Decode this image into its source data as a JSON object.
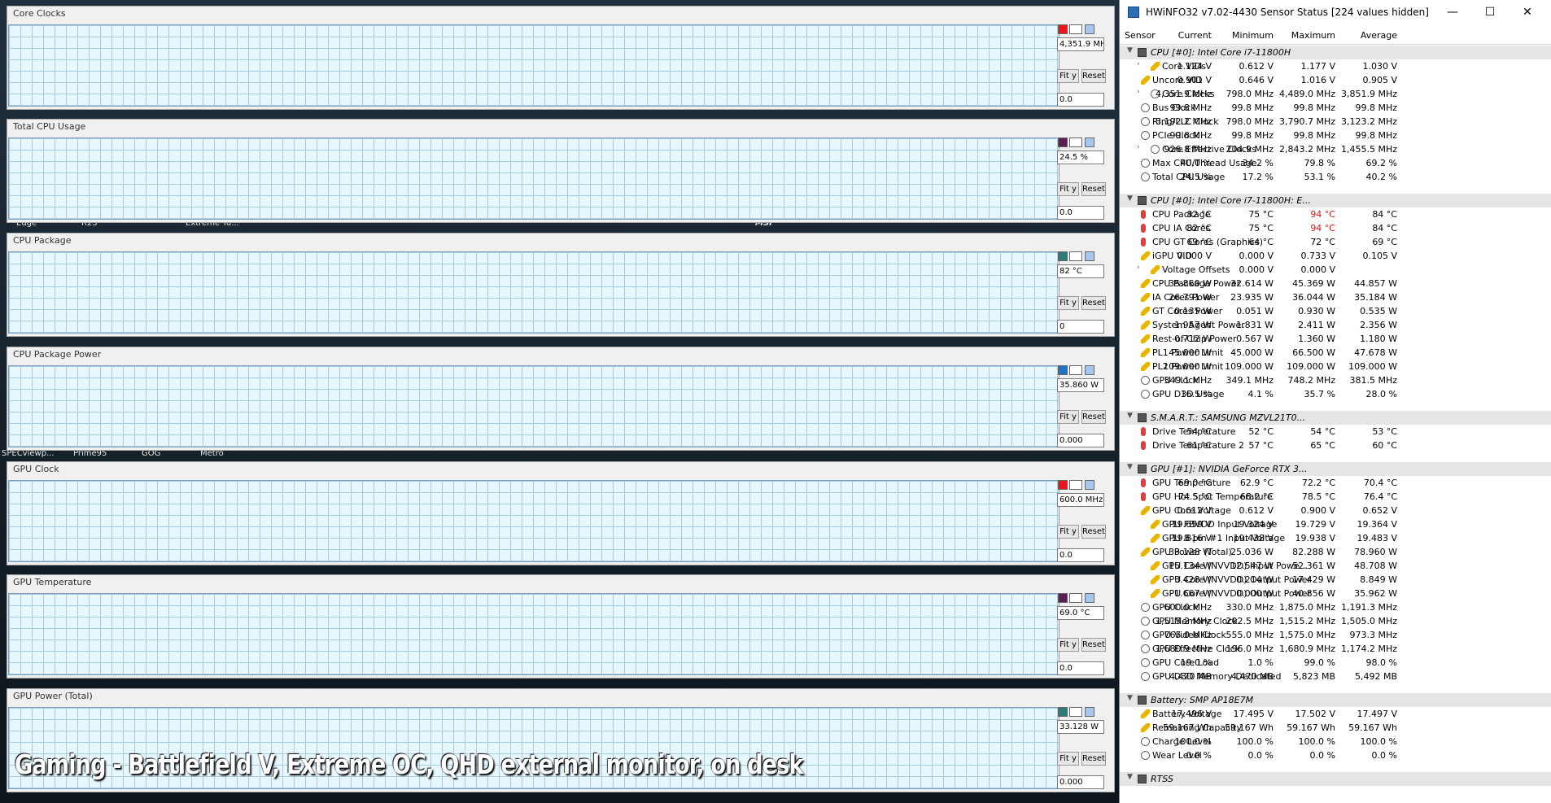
{
  "caption": "Gaming - Battlefield V, Extreme OC, QHD external monitor, on desk",
  "desktop_labels": {
    "row1": [
      "Edge",
      "R23",
      "Extreme Tu..."
    ],
    "row1_right": "MSI",
    "row2": [
      "SPECviewp...",
      "Prime95",
      "GOG",
      "Metro"
    ]
  },
  "graphs": [
    {
      "title": "Core Clocks",
      "value": "4,351.9 MH.",
      "min": "0.0",
      "color": "#f4a3a3",
      "line": "#c8102e",
      "sw": [
        "#e8151d",
        "#ffffff",
        "#a7c8ee"
      ],
      "start": 0.125,
      "level": 0.86,
      "noise": 0.04,
      "spikes": 0.35,
      "drift": 0
    },
    {
      "title": "Total CPU Usage",
      "value": "24.5 %",
      "min": "0.0",
      "color": "#c6b1c8",
      "line": "#4a123f",
      "sw": [
        "#5c1c55",
        "#ffffff",
        "#a7c8ee"
      ],
      "start": 0.125,
      "level": 0.36,
      "noise": 0.05,
      "spikes": 0.08,
      "drift": -0.04
    },
    {
      "title": "CPU Package",
      "value": "82 °C",
      "min": "0",
      "color": "#b7c3c1",
      "line": "#3b7c78",
      "sw": [
        "#2d7c77",
        "#ffffff",
        "#a7c8ee"
      ],
      "start": 0.125,
      "level": 0.66,
      "noise": 0.03,
      "spikes": 0.02,
      "drift": 0.05
    },
    {
      "title": "CPU Package Power",
      "value": "35.860 W",
      "min": "0.000",
      "color": "#a3b8ef",
      "line": "#1a5fa8",
      "sw": [
        "#1f73c2",
        "#ffffff",
        "#a7c8ee"
      ],
      "start": 0.125,
      "level": 0.3,
      "noise": 0.03,
      "spikes": 0.06,
      "drift": -0.1
    },
    {
      "title": "GPU Clock",
      "value": "600.0 MHz",
      "min": "0.0",
      "color": "#f4a3a3",
      "line": "#c8102e",
      "sw": [
        "#e8151d",
        "#ffffff",
        "#a7c8ee"
      ],
      "start": 0.16,
      "level": 0.58,
      "noise": 0.03,
      "spikes": 0.05,
      "drift": -0.06
    },
    {
      "title": "GPU Temperature",
      "value": "69.0 °C",
      "min": "0.0",
      "color": "#c6b1c8",
      "line": "#4a123f",
      "sw": [
        "#5c1c55",
        "#ffffff",
        "#a7c8ee"
      ],
      "start": 0.16,
      "level": 0.55,
      "noise": 0.005,
      "spikes": 0,
      "drift": 0.15
    },
    {
      "title": "GPU Power (Total)",
      "value": "33.128 W",
      "min": "0.000",
      "color": "#b7c3c1",
      "line": "#3b7c78",
      "sw": [
        "#2d7c77",
        "#ffffff",
        "#a7c8ee"
      ],
      "start": 0.16,
      "level": 0.6,
      "noise": 0.03,
      "spikes": 0.02,
      "drift": 0
    }
  ],
  "graph_buttons": {
    "fit": "Fit y",
    "reset": "Reset"
  },
  "window": {
    "title": "HWiNFO32 v7.02-4430 Sensor Status [224 values hidden]",
    "minimize": "—",
    "maximize": "☐",
    "close": "✕"
  },
  "columns": [
    "Sensor",
    "Current",
    "Minimum",
    "Maximum",
    "Average"
  ],
  "rows": [
    {
      "type": "group",
      "name": "CPU [#0]: Intel Core i7-11800H",
      "icon": "chip"
    },
    {
      "name": "Core VIDs",
      "icon": "bolt",
      "indent": 2,
      "expand": true,
      "v": [
        "1.124 V",
        "0.612 V",
        "1.177 V",
        "1.030 V"
      ]
    },
    {
      "name": "Uncore VID",
      "icon": "bolt",
      "v": [
        "0.901 V",
        "0.646 V",
        "1.016 V",
        "0.905 V"
      ]
    },
    {
      "name": "Core Clocks",
      "icon": "clock",
      "indent": 2,
      "expand": true,
      "v": [
        "4,351.9 MHz",
        "798.0 MHz",
        "4,489.0 MHz",
        "3,851.9 MHz"
      ]
    },
    {
      "name": "Bus Clock",
      "icon": "clock",
      "v": [
        "99.8 MHz",
        "99.8 MHz",
        "99.8 MHz",
        "99.8 MHz"
      ]
    },
    {
      "name": "Ring/LLC Clock",
      "icon": "clock",
      "v": [
        "3,192.2 MHz",
        "798.0 MHz",
        "3,790.7 MHz",
        "3,123.2 MHz"
      ]
    },
    {
      "name": "PCIe Clock",
      "icon": "clock",
      "v": [
        "99.8 MHz",
        "99.8 MHz",
        "99.8 MHz",
        "99.8 MHz"
      ]
    },
    {
      "name": "Core Effective Clocks",
      "icon": "clock",
      "indent": 2,
      "expand": true,
      "v": [
        "926.8 MHz",
        "204.9 MHz",
        "2,843.2 MHz",
        "1,455.5 MHz"
      ]
    },
    {
      "name": "Max CPU/Thread Usage",
      "icon": "clock",
      "v": [
        "40.0 %",
        "34.2 %",
        "79.8 %",
        "69.2 %"
      ]
    },
    {
      "name": "Total CPU Usage",
      "icon": "clock",
      "v": [
        "24.5 %",
        "17.2 %",
        "53.1 %",
        "40.2 %"
      ]
    },
    {
      "type": "gap"
    },
    {
      "type": "group",
      "name": "CPU [#0]: Intel Core i7-11800H: E...",
      "icon": "chip"
    },
    {
      "name": "CPU Package",
      "icon": "therm",
      "v": [
        "82 °C",
        "75 °C",
        "94 °C",
        "84 °C"
      ],
      "hot": 2
    },
    {
      "name": "CPU IA Cores",
      "icon": "therm",
      "v": [
        "82 °C",
        "75 °C",
        "94 °C",
        "84 °C"
      ],
      "hot": 2
    },
    {
      "name": "CPU GT Cores (Graphics)",
      "icon": "therm",
      "v": [
        "69 °C",
        "64 °C",
        "72 °C",
        "69 °C"
      ]
    },
    {
      "name": "iGPU VID",
      "icon": "bolt",
      "v": [
        "0.000 V",
        "0.000 V",
        "0.733 V",
        "0.105 V"
      ]
    },
    {
      "name": "Voltage Offsets",
      "icon": "bolt",
      "indent": 2,
      "expand": true,
      "v": [
        "",
        "0.000 V",
        "0.000 V",
        ""
      ]
    },
    {
      "name": "CPU Package Power",
      "icon": "bolt",
      "v": [
        "35.860 W",
        "32.614 W",
        "45.369 W",
        "44.857 W"
      ]
    },
    {
      "name": "IA Cores Power",
      "icon": "bolt",
      "v": [
        "26.791 W",
        "23.935 W",
        "36.044 W",
        "35.184 W"
      ]
    },
    {
      "name": "GT Cores Power",
      "icon": "bolt",
      "v": [
        "0.135 W",
        "0.051 W",
        "0.930 W",
        "0.535 W"
      ]
    },
    {
      "name": "System Agent Power",
      "icon": "bolt",
      "v": [
        "1.957 W",
        "1.831 W",
        "2.411 W",
        "2.356 W"
      ]
    },
    {
      "name": "Rest-of-Chip Power",
      "icon": "bolt",
      "v": [
        "0.712 W",
        "0.567 W",
        "1.360 W",
        "1.180 W"
      ]
    },
    {
      "name": "PL1 Power Limit",
      "icon": "bolt",
      "v": [
        "45.000 W",
        "45.000 W",
        "66.500 W",
        "47.678 W"
      ]
    },
    {
      "name": "PL2 Power Limit",
      "icon": "bolt",
      "v": [
        "109.000 W",
        "109.000 W",
        "109.000 W",
        "109.000 W"
      ]
    },
    {
      "name": "GPU Clock",
      "icon": "clock",
      "v": [
        "349.1 MHz",
        "349.1 MHz",
        "748.2 MHz",
        "381.5 MHz"
      ]
    },
    {
      "name": "GPU D3D Usage",
      "icon": "clock",
      "v": [
        "16.5 %",
        "4.1 %",
        "35.7 %",
        "28.0 %"
      ]
    },
    {
      "type": "gap"
    },
    {
      "type": "group",
      "name": "S.M.A.R.T.: SAMSUNG MZVL21T0...",
      "icon": "chip"
    },
    {
      "name": "Drive Temperature",
      "icon": "therm",
      "v": [
        "54 °C",
        "52 °C",
        "54 °C",
        "53 °C"
      ]
    },
    {
      "name": "Drive Temperature 2",
      "icon": "therm",
      "v": [
        "61 °C",
        "57 °C",
        "65 °C",
        "60 °C"
      ]
    },
    {
      "type": "gap"
    },
    {
      "type": "group",
      "name": "GPU [#1]: NVIDIA GeForce RTX 3...",
      "icon": "chip"
    },
    {
      "name": "GPU Temperature",
      "icon": "therm",
      "v": [
        "69.0 °C",
        "62.9 °C",
        "72.2 °C",
        "70.4 °C"
      ]
    },
    {
      "name": "GPU Hot Spot Temperature",
      "icon": "therm",
      "v": [
        "74.5 °C",
        "68.2 °C",
        "78.5 °C",
        "76.4 °C"
      ]
    },
    {
      "name": "GPU Core Voltage",
      "icon": "bolt",
      "v": [
        "0.612 V",
        "0.612 V",
        "0.900 V",
        "0.652 V"
      ]
    },
    {
      "name": "GPU FBVDD Input Voltage",
      "icon": "bolt",
      "indent": 2,
      "v": [
        "19.659 V",
        "19.324 V",
        "19.729 V",
        "19.364 V"
      ]
    },
    {
      "name": "GPU 8-pin #1 Input Voltage",
      "icon": "bolt",
      "indent": 2,
      "v": [
        "19.816 V",
        "19.438 V",
        "19.938 V",
        "19.483 V"
      ]
    },
    {
      "name": "GPU Power (Total)",
      "icon": "bolt",
      "v": [
        "33.128 W",
        "25.036 W",
        "82.288 W",
        "78.960 W"
      ]
    },
    {
      "name": "GPU Core (NVVDD) Input Powe...",
      "icon": "bolt",
      "indent": 2,
      "v": [
        "15.134 W",
        "12.547 W",
        "52.361 W",
        "48.708 W"
      ]
    },
    {
      "name": "GPU Core (NVVDD) Output Power",
      "icon": "bolt",
      "indent": 2,
      "v": [
        "3.428 W",
        "0.214 W",
        "17.429 W",
        "8.849 W"
      ]
    },
    {
      "name": "GPU Core (NVVDD) Output Power",
      "icon": "bolt",
      "indent": 2,
      "v": [
        "1.667 W",
        "0.000 W",
        "40.856 W",
        "35.962 W"
      ]
    },
    {
      "name": "GPU Clock",
      "icon": "clock",
      "v": [
        "600.0 MHz",
        "330.0 MHz",
        "1,875.0 MHz",
        "1,191.3 MHz"
      ]
    },
    {
      "name": "GPU Memory Clock",
      "icon": "clock",
      "v": [
        "1,515.2 MHz",
        "202.5 MHz",
        "1,515.2 MHz",
        "1,505.0 MHz"
      ]
    },
    {
      "name": "GPU Video Clock",
      "icon": "clock",
      "v": [
        "765.0 MHz",
        "555.0 MHz",
        "1,575.0 MHz",
        "973.3 MHz"
      ]
    },
    {
      "name": "GPU Effective Clock",
      "icon": "clock",
      "v": [
        "1,680.9 MHz",
        "196.0 MHz",
        "1,680.9 MHz",
        "1,174.2 MHz"
      ]
    },
    {
      "name": "GPU Core Load",
      "icon": "clock",
      "v": [
        "19.0 %",
        "1.0 %",
        "99.0 %",
        "98.0 %"
      ]
    },
    {
      "name": "GPU D3D Memory Dedicated",
      "icon": "clock",
      "v": [
        "4,470 MB",
        "4,470 MB",
        "5,823 MB",
        "5,492 MB"
      ]
    },
    {
      "type": "gap"
    },
    {
      "type": "group",
      "name": "Battery: SMP  AP18E7M",
      "icon": "chip"
    },
    {
      "name": "Battery Voltage",
      "icon": "bolt",
      "v": [
        "17.496 V",
        "17.495 V",
        "17.502 V",
        "17.497 V"
      ]
    },
    {
      "name": "Remaining Capacity",
      "icon": "bolt",
      "v": [
        "59.167 Wh",
        "59.167 Wh",
        "59.167 Wh",
        "59.167 Wh"
      ]
    },
    {
      "name": "Charge Level",
      "icon": "clock",
      "v": [
        "100.0 %",
        "100.0 %",
        "100.0 %",
        "100.0 %"
      ]
    },
    {
      "name": "Wear Level",
      "icon": "clock",
      "v": [
        "0.0 %",
        "0.0 %",
        "0.0 %",
        "0.0 %"
      ]
    },
    {
      "type": "gap"
    },
    {
      "type": "group",
      "name": "RTSS",
      "icon": "chip"
    }
  ]
}
